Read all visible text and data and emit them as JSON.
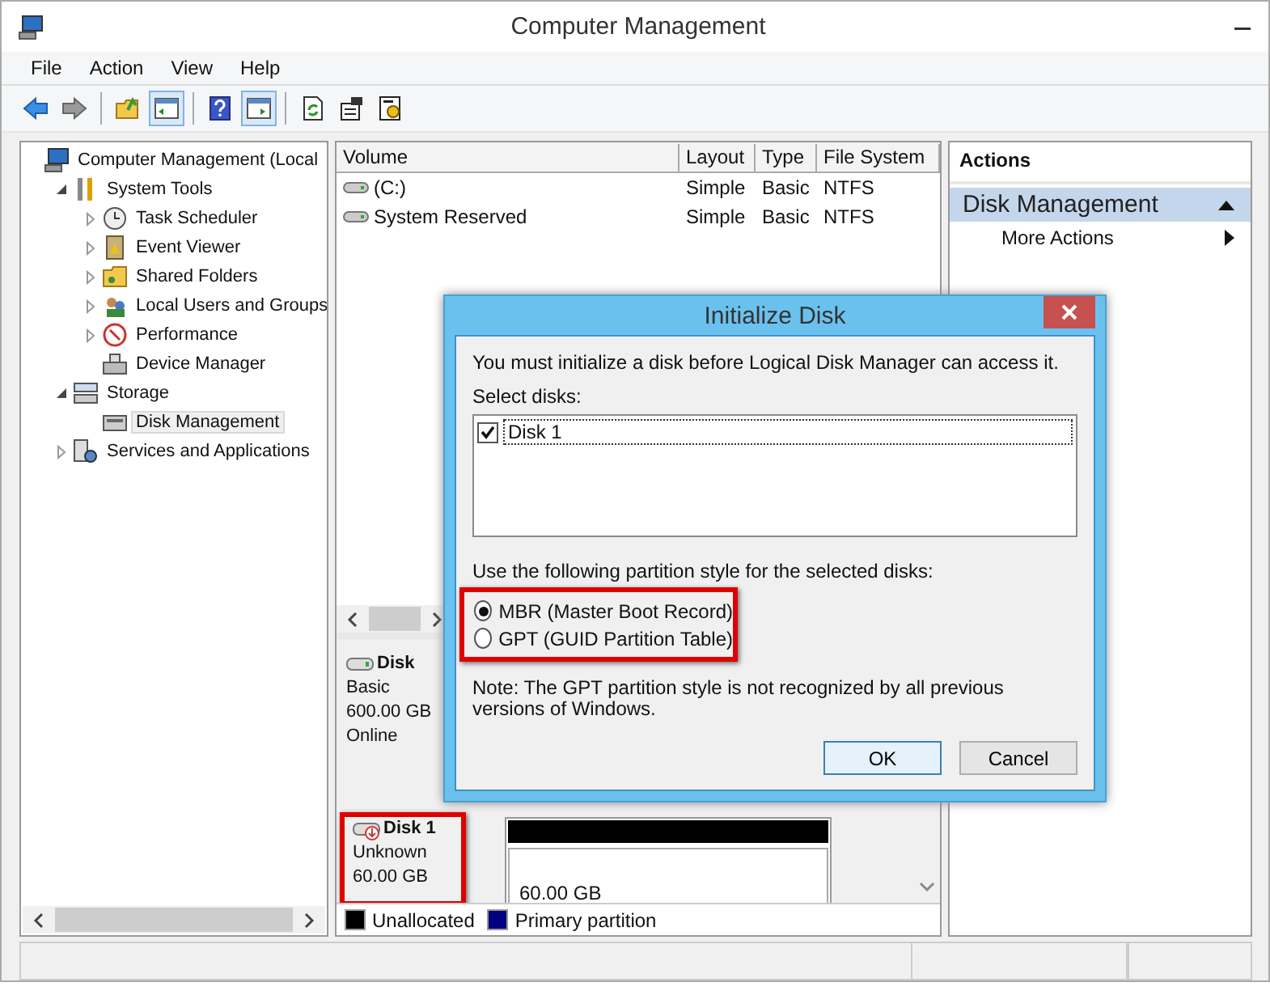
{
  "window": {
    "title": "Computer Management"
  },
  "menu": [
    "File",
    "Action",
    "View",
    "Help"
  ],
  "toolbar_groups": [
    [
      {
        "pressed": false
      },
      {
        "pressed": false
      }
    ],
    [
      {
        "pressed": false
      },
      {
        "pressed": true
      }
    ],
    [
      {
        "pressed": false
      },
      {
        "pressed": true
      }
    ],
    [
      {
        "pressed": false
      },
      {
        "pressed": false
      },
      {
        "pressed": false
      }
    ]
  ],
  "tree": [
    {
      "label": "Computer Management (Local",
      "selected": false,
      "children": [
        {
          "label": "System Tools",
          "expanded": true,
          "selected": false,
          "children": [
            {
              "label": "Task Scheduler",
              "expanded": false,
              "selected": false
            },
            {
              "label": "Event Viewer",
              "expanded": false,
              "selected": false
            },
            {
              "label": "Shared Folders",
              "expanded": false,
              "selected": false
            },
            {
              "label": "Local Users and Groups",
              "expanded": false,
              "selected": false
            },
            {
              "label": "Performance",
              "expanded": false,
              "selected": false
            },
            {
              "label": "Device Manager",
              "selected": false
            }
          ]
        },
        {
          "label": "Storage",
          "expanded": true,
          "selected": false,
          "children": [
            {
              "label": "Disk Management",
              "selected": true
            }
          ]
        },
        {
          "label": "Services and Applications",
          "expanded": false,
          "selected": false
        }
      ]
    }
  ],
  "volumes": {
    "columns": [
      "Volume",
      "Layout",
      "Type",
      "File System"
    ],
    "rows": [
      [
        "(C:)",
        "Simple",
        "Basic",
        "NTFS"
      ],
      [
        "System Reserved",
        "Simple",
        "Basic",
        "NTFS"
      ]
    ]
  },
  "disks": [
    {
      "lines": [
        "Disk",
        "Basic",
        "600.00 GB",
        "Online"
      ],
      "highlighted": false
    },
    {
      "lines": [
        "Disk 1",
        "Unknown",
        "60.00 GB"
      ],
      "highlighted": true,
      "partitions": [
        {
          "size": "60.00 GB",
          "color": "#000000"
        }
      ]
    }
  ],
  "legend": [
    {
      "label": "Unallocated",
      "color": "#000000"
    },
    {
      "label": "Primary partition",
      "color": "#000080"
    }
  ],
  "actions": {
    "title": "Actions",
    "section": "Disk Management",
    "items": [
      "More Actions"
    ]
  },
  "dialog": {
    "title": "Initialize Disk",
    "message": "You must initialize a disk before Logical Disk Manager can access it.",
    "select_label": "Select disks:",
    "disks": [
      {
        "label": "Disk 1",
        "checked": true
      }
    ],
    "style_label": "Use the following partition style for the selected disks:",
    "styles": [
      {
        "label": "MBR (Master Boot Record)",
        "selected": true
      },
      {
        "label": "GPT (GUID Partition Table)",
        "selected": false
      }
    ],
    "styles_highlighted": true,
    "note": "Note: The GPT partition style is not recognized by all previous versions of Windows.",
    "buttons": [
      {
        "label": "OK",
        "default": true
      },
      {
        "label": "Cancel",
        "default": false
      }
    ]
  }
}
